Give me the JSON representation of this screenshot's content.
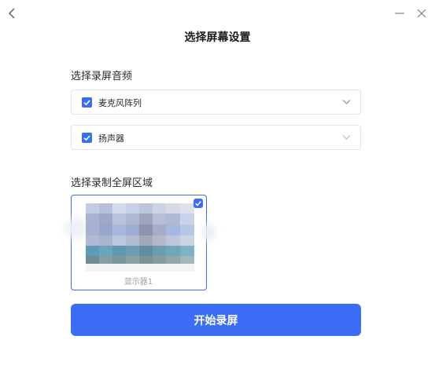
{
  "window": {
    "back_icon": "chevron-left-icon",
    "minimize_icon": "minimize-icon",
    "close_icon": "close-icon"
  },
  "page": {
    "title": "选择屏幕设置"
  },
  "audio": {
    "label": "选择录屏音频",
    "options": [
      {
        "label": "麦克风阵列",
        "checked": true
      },
      {
        "label": "扬声器",
        "checked": true
      }
    ]
  },
  "area": {
    "label": "选择录制全屏区域",
    "monitors": [
      {
        "name": "显示器1",
        "selected": true
      }
    ]
  },
  "actions": {
    "start_label": "开始录屏"
  },
  "colors": {
    "accent": "#3a6cf6",
    "border": "#dfe2e8",
    "muted_text": "#9a9ea6"
  }
}
